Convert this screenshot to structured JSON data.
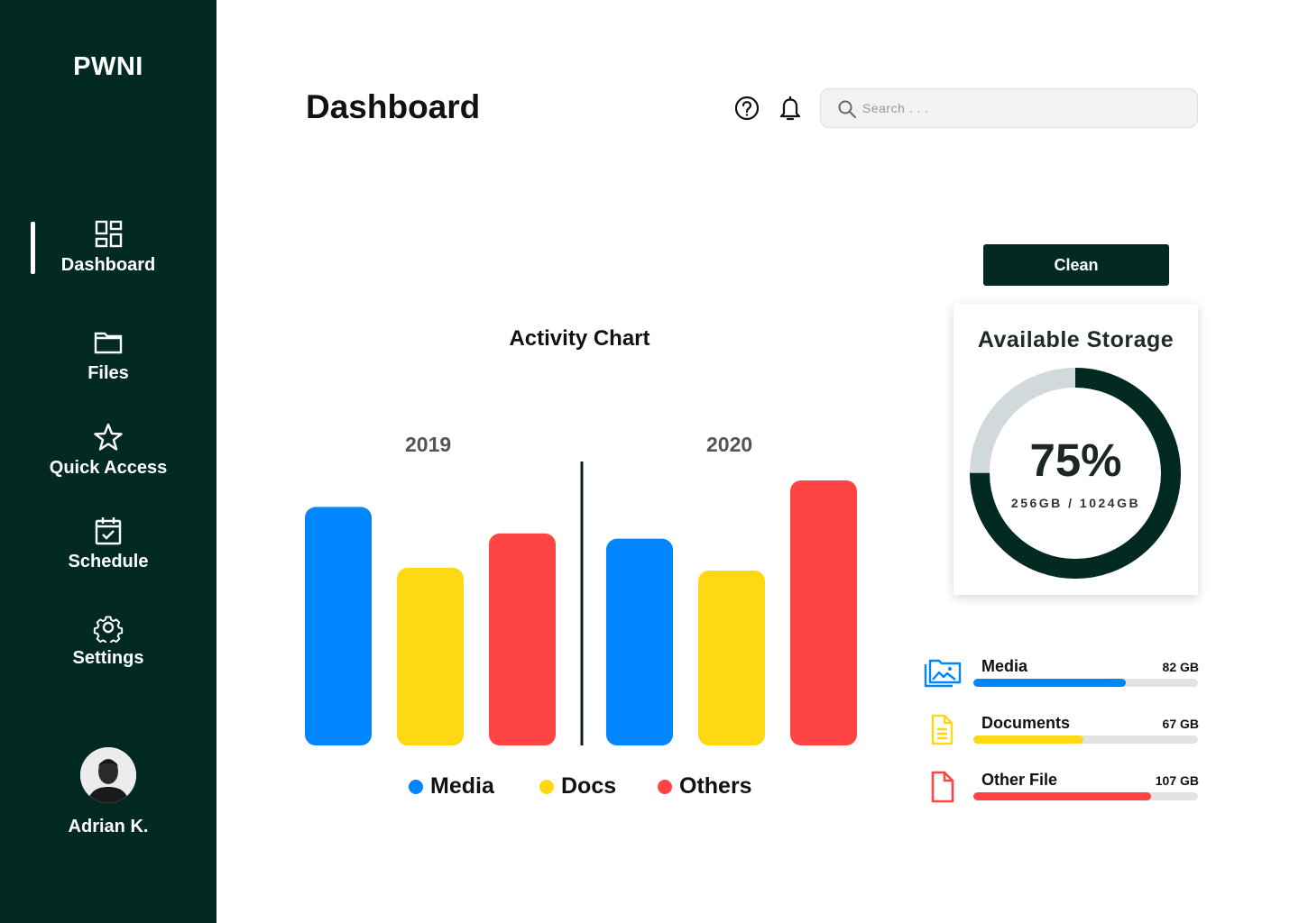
{
  "sidebar": {
    "brand": "PWNI",
    "items": [
      {
        "label": "Dashboard",
        "icon": "dashboard-grid-icon",
        "active": true
      },
      {
        "label": "Files",
        "icon": "folder-icon",
        "active": false
      },
      {
        "label": "Quick Access",
        "icon": "star-icon",
        "active": false
      },
      {
        "label": "Schedule",
        "icon": "calendar-check-icon",
        "active": false
      },
      {
        "label": "Settings",
        "icon": "gear-icon",
        "active": false
      }
    ],
    "user": {
      "name": "Adrian K."
    }
  },
  "header": {
    "title": "Dashboard",
    "search_placeholder": "Search . . .",
    "icons": [
      "help-icon",
      "bell-icon"
    ]
  },
  "colors": {
    "sidebar_bg": "#022a22",
    "media": "#0086ff",
    "docs": "#ffd814",
    "others": "#ff4444",
    "track": "#e2e2e2",
    "donut_rest": "#d2d9dc"
  },
  "chart_data": {
    "type": "bar",
    "title": "Activity Chart",
    "categories": [
      "2019",
      "2020"
    ],
    "series": [
      {
        "name": "Media",
        "color": "#0086ff",
        "values": [
          90,
          78
        ]
      },
      {
        "name": "Docs",
        "color": "#ffd814",
        "values": [
          67,
          66
        ]
      },
      {
        "name": "Others",
        "color": "#ff4444",
        "values": [
          80,
          100
        ]
      }
    ],
    "ylim": [
      0,
      100
    ],
    "grid": false,
    "legend": "bottom"
  },
  "storage": {
    "clean_label": "Clean",
    "title": "Available Storage",
    "percent_label": "75%",
    "percent": 0.75,
    "detail": "256GB / 1024GB",
    "items": [
      {
        "name": "Media",
        "size": "82 GB",
        "fill": 0.68,
        "color": "#0086ff",
        "icon": "media-images-icon"
      },
      {
        "name": "Documents",
        "size": "67 GB",
        "fill": 0.49,
        "color": "#ffd814",
        "icon": "document-icon"
      },
      {
        "name": "Other File",
        "size": "107 GB",
        "fill": 0.79,
        "color": "#ff4444",
        "icon": "file-icon"
      }
    ]
  }
}
